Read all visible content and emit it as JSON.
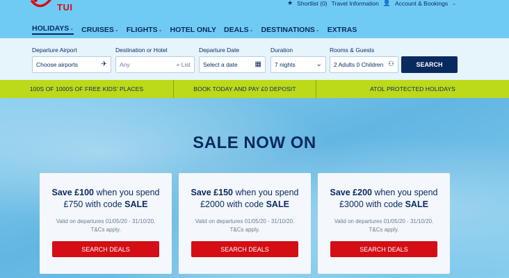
{
  "brand": {
    "name": "TUI",
    "color": "#d40e14"
  },
  "toplinks": {
    "shortlist": "Shortlist (0)",
    "travel_info": "Travel Information",
    "account": "Account & Bookings"
  },
  "nav": [
    {
      "label": "HOLIDAYS",
      "dropdown": true,
      "active": true
    },
    {
      "label": "CRUISES",
      "dropdown": true
    },
    {
      "label": "FLIGHTS",
      "dropdown": true
    },
    {
      "label": "HOTEL ONLY",
      "dropdown": false
    },
    {
      "label": "DEALS",
      "dropdown": true
    },
    {
      "label": "DESTINATIONS",
      "dropdown": true
    },
    {
      "label": "EXTRAS",
      "dropdown": false
    }
  ],
  "search": {
    "departure_label": "Departure Airport",
    "departure_value": "Choose airports",
    "destination_label": "Destination or Hotel",
    "destination_placeholder": "Any",
    "destination_list": "List",
    "date_label": "Departure Date",
    "date_value": "Select a date",
    "duration_label": "Duration",
    "duration_value": "7 nights",
    "rooms_label": "Rooms & Guests",
    "rooms_value": "2 Adults 0 Children",
    "button": "SEARCH"
  },
  "usp": [
    "100S OF 1000S OF FREE KIDS' PLACES",
    "BOOK TODAY AND PAY £0 DEPOSIT",
    "ATOL PROTECTED HOLIDAYS"
  ],
  "hero": {
    "title": "SALE NOW ON"
  },
  "cards": [
    {
      "save": "Save £100",
      "when": " when you spend",
      "spend": "£750 with code ",
      "code": "SALE",
      "valid": "Valid on departures 01/05/20 - 31/10/20.",
      "tcs": "T&Cs apply.",
      "button": "SEARCH DEALS"
    },
    {
      "save": "Save £150",
      "when": " when you spend",
      "spend": "£2000 with code ",
      "code": "SALE",
      "valid": "Valid on departures 01/05/20 - 31/10/20.",
      "tcs": "T&Cs apply.",
      "button": "SEARCH DEALS"
    },
    {
      "save": "Save £200",
      "when": " when you spend",
      "spend": "£3000 with code ",
      "code": "SALE",
      "valid": "Valid on departures 01/05/20 - 31/10/20.",
      "tcs": "T&Cs apply.",
      "button": "SEARCH DEALS"
    }
  ],
  "colors": {
    "navy": "#092a5e",
    "sky": "#70cbf4",
    "lime": "#bcd91a",
    "red": "#d40e14"
  }
}
